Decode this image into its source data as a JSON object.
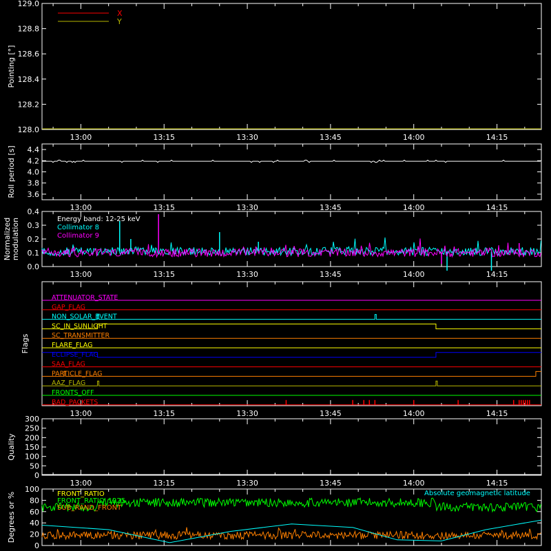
{
  "chart_data": [
    {
      "type": "line",
      "ylabel": "Pointing [°]",
      "ylim": [
        128.0,
        129.0
      ],
      "yticks": [
        "128.0",
        "128.2",
        "128.4",
        "128.6",
        "128.8",
        "129.0"
      ],
      "xticks": [
        "13:00",
        "13:15",
        "13:30",
        "13:45",
        "14:00",
        "14:15"
      ],
      "xlim": [
        "12:53",
        "14:23"
      ],
      "legend_position": "top-left",
      "series": [
        {
          "name": "X",
          "color": "#ff0000",
          "values": []
        },
        {
          "name": "Y",
          "color": "#b8b800",
          "values": []
        }
      ]
    },
    {
      "type": "line",
      "ylabel": "Roll period [s]",
      "ylim": [
        3.5,
        4.5
      ],
      "yticks": [
        "3.6",
        "3.8",
        "4.0",
        "4.2",
        "4.4"
      ],
      "xticks": [
        "13:00",
        "13:15",
        "13:30",
        "13:45",
        "14:00",
        "14:15"
      ],
      "series": [
        {
          "color": "#ffffff",
          "x": [
            "12:53",
            "14:23"
          ],
          "values": [
            4.19,
            4.19
          ]
        }
      ]
    },
    {
      "type": "line",
      "ylabel": "Normalized modulation",
      "ylim": [
        0.0,
        0.4
      ],
      "yticks": [
        "0.0",
        "0.1",
        "0.2",
        "0.3",
        "0.4"
      ],
      "xticks": [
        "13:00",
        "13:15",
        "13:30",
        "13:45",
        "14:00",
        "14:15"
      ],
      "annotation": "Energy band: 12-25 keV",
      "series": [
        {
          "name": "Collimator 8",
          "color": "#00ffff",
          "baseline": 0.11,
          "spikes": [
            {
              "x": "13:07",
              "y": 0.33
            },
            {
              "x": "13:09",
              "y": 0.2
            },
            {
              "x": "13:25",
              "y": 0.25
            },
            {
              "x": "13:32",
              "y": 0.18
            },
            {
              "x": "14:06",
              "y": -0.03
            },
            {
              "x": "14:14",
              "y": -0.05
            }
          ]
        },
        {
          "name": "Collimator 9",
          "color": "#ff00ff",
          "baseline": 0.1,
          "spikes": [
            {
              "x": "13:14",
              "y": 0.38
            },
            {
              "x": "14:05",
              "y": 0.02
            },
            {
              "x": "14:19",
              "y": 0.17
            }
          ]
        }
      ]
    },
    {
      "type": "line",
      "ylabel": "Flags",
      "xticks": [
        "13:00",
        "13:15",
        "13:30",
        "13:45",
        "14:00",
        "14:15"
      ],
      "flags": [
        {
          "name": "ATTENUATOR_STATE",
          "color": "#ff00ff",
          "on": []
        },
        {
          "name": "GAP_FLAG",
          "color": "#ff0000",
          "on": []
        },
        {
          "name": "NON_SOLAR_EVENT",
          "color": "#00ffff",
          "on": [
            [
              "13:03",
              "13:03"
            ],
            [
              "13:53",
              "13:53"
            ]
          ]
        },
        {
          "name": "SC_IN_SUNLIGHT",
          "color": "#ffff00",
          "on": [
            [
              "13:03",
              "14:04"
            ]
          ]
        },
        {
          "name": "SC_TRANSMITTER",
          "color": "#ff8000",
          "on": []
        },
        {
          "name": "FLARE_FLAG",
          "color": "#ffff00",
          "on": []
        },
        {
          "name": "ECLIPSE_FLAG",
          "color": "#0000ff",
          "on": [
            [
              "12:53",
              "13:03"
            ],
            [
              "14:04",
              "14:23"
            ]
          ]
        },
        {
          "name": "SAA_FLAG",
          "color": "#ff0000",
          "on": []
        },
        {
          "name": "PARTICLE_FLAG",
          "color": "#ff8000",
          "on": [
            [
              "12:57",
              "12:57"
            ],
            [
              "14:22",
              "14:23"
            ]
          ]
        },
        {
          "name": "AAZ_FLAG",
          "color": "#b8b800",
          "on": [
            [
              "13:03",
              "13:03"
            ],
            [
              "14:04",
              "14:04"
            ]
          ]
        },
        {
          "name": "FRONTS_OFF",
          "color": "#00ff00",
          "on": []
        },
        {
          "name": "BAD_PACKETS",
          "color": "#ff0000",
          "on": [
            [
              "13:37",
              "13:37"
            ],
            [
              "13:49",
              "13:49"
            ],
            [
              "13:51",
              "13:51"
            ],
            [
              "13:52",
              "13:52"
            ],
            [
              "13:53",
              "13:53"
            ],
            [
              "14:00",
              "14:00"
            ],
            [
              "14:08",
              "14:08"
            ],
            [
              "14:18",
              "14:18"
            ],
            [
              "14:19",
              "14:21"
            ]
          ]
        }
      ]
    },
    {
      "type": "line",
      "ylabel": "Quality",
      "ylim": [
        0,
        300
      ],
      "yticks": [
        "0",
        "50",
        "100",
        "150",
        "200",
        "250",
        "300"
      ],
      "xticks": [
        "13:00",
        "13:15",
        "13:30",
        "13:45",
        "14:00",
        "14:15"
      ],
      "series": [
        {
          "color": "#ffffff",
          "x": [
            "12:53",
            "14:23"
          ],
          "values": [
            0,
            0
          ]
        }
      ]
    },
    {
      "type": "line",
      "ylabel": "Degrees or %",
      "ylim": [
        0,
        100
      ],
      "yticks": [
        "0",
        "20",
        "40",
        "60",
        "80",
        "100"
      ],
      "annotation": "Absolute geomagnetic latitude",
      "series": [
        {
          "name": "FRONT_RATIO",
          "color": "#ffff00",
          "values": []
        },
        {
          "name": "FRONT_RATIO_1225",
          "color": "#00ff00",
          "level": "~75 in sunlight, ~70 in eclipse"
        },
        {
          "name": "SUB_RAND_FRONT",
          "color": "#ff8000",
          "level": "~20"
        },
        {
          "name": "Absolute geomagnetic latitude",
          "color": "#00ffff",
          "x": [
            "12:53",
            "13:05",
            "13:16",
            "13:27",
            "13:38",
            "13:49",
            "13:57",
            "14:05",
            "14:13",
            "14:23"
          ],
          "values": [
            36,
            28,
            5,
            25,
            38,
            32,
            10,
            8,
            28,
            45
          ]
        }
      ]
    }
  ]
}
